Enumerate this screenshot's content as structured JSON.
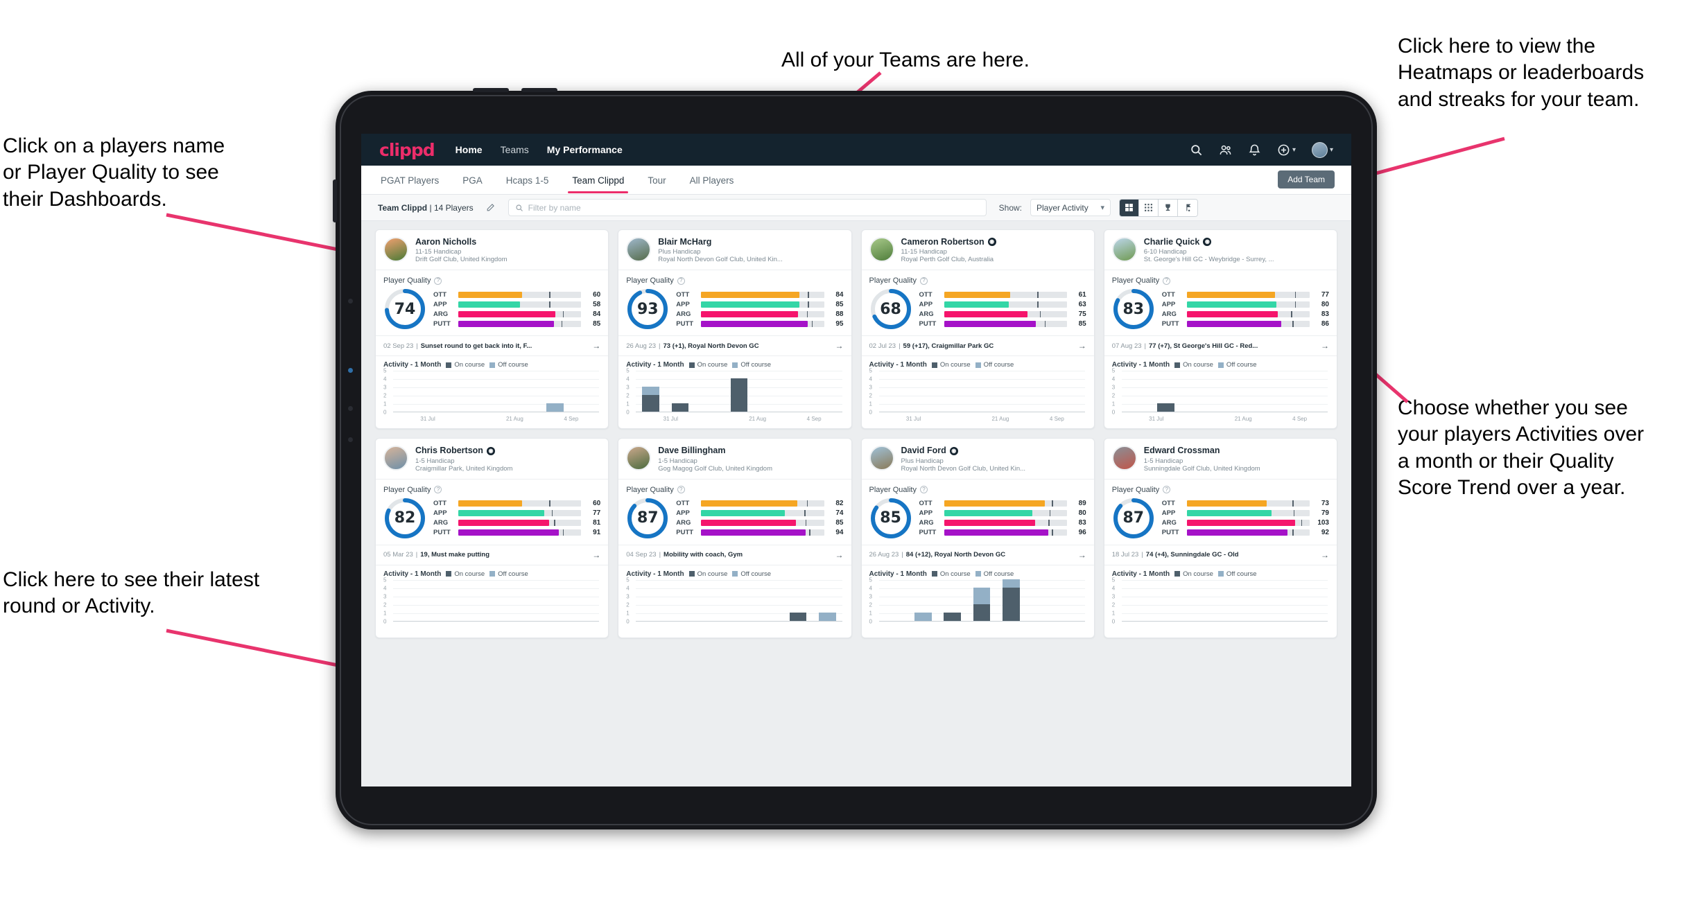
{
  "annotations": [
    {
      "id": "teams",
      "text": "All of your Teams are here."
    },
    {
      "id": "heatmaps",
      "text": "Click here to view the\nHeatmaps or leaderboards\nand streaks for your team."
    },
    {
      "id": "dashboards",
      "text": "Click on a players name\nor Player Quality to see\ntheir Dashboards."
    },
    {
      "id": "choose",
      "text": "Choose whether you see\nyour players Activities over\na month or their Quality\nScore Trend over a year."
    },
    {
      "id": "latest",
      "text": "Click here to see their latest\nround or Activity."
    }
  ],
  "app": {
    "brand": "clippd",
    "nav": [
      {
        "label": "Home",
        "active": true
      },
      {
        "label": "Teams",
        "active": false
      },
      {
        "label": "My Performance",
        "active": true
      }
    ],
    "nav_icons": [
      "search-icon",
      "people-icon",
      "bell-icon",
      "plus-circle-icon",
      "avatar"
    ],
    "tabs": [
      {
        "label": "PGAT Players",
        "active": false
      },
      {
        "label": "PGA",
        "active": false
      },
      {
        "label": "Hcaps 1-5",
        "active": false
      },
      {
        "label": "Team Clippd",
        "active": true
      },
      {
        "label": "Tour",
        "active": false
      },
      {
        "label": "All Players",
        "active": false
      }
    ],
    "add_team_label": "Add Team",
    "filter": {
      "team_name": "Team Clippd",
      "team_sep": "|",
      "player_count": "14 Players",
      "edit_icon": "pencil-icon",
      "search_placeholder": "Filter by name",
      "show_label": "Show:",
      "show_value": "Player Activity",
      "view_buttons": [
        {
          "icon": "grid-large-icon",
          "active": true
        },
        {
          "icon": "grid-small-icon",
          "active": false
        },
        {
          "icon": "trophy-icon",
          "active": false
        },
        {
          "icon": "flag-icon",
          "active": false
        }
      ]
    },
    "card_labels": {
      "player_quality": "Player Quality",
      "activity": "Activity - 1 Month",
      "on_course": "On course",
      "off_course": "Off course",
      "help_icon": "question-icon",
      "arrow_icon": "arrow-right-icon"
    },
    "colors": {
      "brand_pink": "#ec2d6a",
      "navbar": "#14232e",
      "ring": "#1675c4",
      "ott": "#f5a623",
      "app": "#33d6a6",
      "arg": "#f5156c",
      "putt": "#a512c8",
      "on_course": "#4e5f6b",
      "off_course": "#93b0c6"
    },
    "players": [
      {
        "name": "Aaron Nicholls",
        "verified": false,
        "handicap": "11-15 Handicap",
        "club": "Drift Golf Club, United Kingdom",
        "quality": 74,
        "skills": [
          {
            "label": "OTT",
            "value": 60,
            "fill": 52,
            "tick": 74
          },
          {
            "label": "APP",
            "value": 58,
            "fill": 50,
            "tick": 74
          },
          {
            "label": "ARG",
            "value": 84,
            "fill": 79,
            "tick": 85
          },
          {
            "label": "PUTT",
            "value": 85,
            "fill": 78,
            "tick": 84
          }
        ],
        "round": {
          "date": "02 Sep 23",
          "text": "Sunset round to get back into it, F..."
        },
        "chart": {
          "ylabels": [
            5,
            4,
            3,
            2,
            1,
            0
          ],
          "ymax": 5,
          "xlabels": [
            {
              "text": "31 Jul",
              "pos": 16
            },
            {
              "text": "21 Aug",
              "pos": 56
            },
            {
              "text": "4 Sep",
              "pos": 82
            }
          ],
          "bars": [
            {
              "on": 0,
              "off": 0
            },
            {
              "on": 0,
              "off": 0
            },
            {
              "on": 0,
              "off": 0
            },
            {
              "on": 0,
              "off": 0
            },
            {
              "on": 0,
              "off": 0
            },
            {
              "on": 0,
              "off": 1
            },
            {
              "on": 0,
              "off": 0
            }
          ]
        }
      },
      {
        "name": "Blair McHarg",
        "verified": false,
        "handicap": "Plus Handicap",
        "club": "Royal North Devon Golf Club, United Kin...",
        "quality": 93,
        "skills": [
          {
            "label": "OTT",
            "value": 84,
            "fill": 80,
            "tick": 87
          },
          {
            "label": "APP",
            "value": 85,
            "fill": 80,
            "tick": 87
          },
          {
            "label": "ARG",
            "value": 88,
            "fill": 79,
            "tick": 86
          },
          {
            "label": "PUTT",
            "value": 95,
            "fill": 87,
            "tick": 90
          }
        ],
        "round": {
          "date": "26 Aug 23",
          "text": "73 (+1), Royal North Devon GC"
        },
        "chart": {
          "ylabels": [
            5,
            4,
            3,
            2,
            1,
            0
          ],
          "ymax": 5,
          "xlabels": [
            {
              "text": "31 Jul",
              "pos": 16
            },
            {
              "text": "21 Aug",
              "pos": 56
            },
            {
              "text": "4 Sep",
              "pos": 82
            }
          ],
          "bars": [
            {
              "on": 2,
              "off": 1
            },
            {
              "on": 1,
              "off": 0
            },
            {
              "on": 0,
              "off": 0
            },
            {
              "on": 4,
              "off": 0
            },
            {
              "on": 0,
              "off": 0
            },
            {
              "on": 0,
              "off": 0
            },
            {
              "on": 0,
              "off": 0
            }
          ]
        }
      },
      {
        "name": "Cameron Robertson",
        "verified": true,
        "handicap": "11-15 Handicap",
        "club": "Royal Perth Golf Club, Australia",
        "quality": 68,
        "skills": [
          {
            "label": "OTT",
            "value": 61,
            "fill": 54,
            "tick": 76
          },
          {
            "label": "APP",
            "value": 63,
            "fill": 53,
            "tick": 76
          },
          {
            "label": "ARG",
            "value": 75,
            "fill": 68,
            "tick": 78
          },
          {
            "label": "PUTT",
            "value": 85,
            "fill": 75,
            "tick": 82
          }
        ],
        "round": {
          "date": "02 Jul 23",
          "text": "59 (+17), Craigmillar Park GC"
        },
        "chart": {
          "ylabels": [
            5,
            4,
            3,
            2,
            1,
            0
          ],
          "ymax": 5,
          "xlabels": [
            {
              "text": "31 Jul",
              "pos": 16
            },
            {
              "text": "21 Aug",
              "pos": 56
            },
            {
              "text": "4 Sep",
              "pos": 82
            }
          ],
          "bars": [
            {
              "on": 0,
              "off": 0
            },
            {
              "on": 0,
              "off": 0
            },
            {
              "on": 0,
              "off": 0
            },
            {
              "on": 0,
              "off": 0
            },
            {
              "on": 0,
              "off": 0
            },
            {
              "on": 0,
              "off": 0
            },
            {
              "on": 0,
              "off": 0
            }
          ]
        }
      },
      {
        "name": "Charlie Quick",
        "verified": true,
        "handicap": "6-10 Handicap",
        "club": "St. George's Hill GC - Weybridge - Surrey, ...",
        "quality": 83,
        "skills": [
          {
            "label": "OTT",
            "value": 77,
            "fill": 72,
            "tick": 88
          },
          {
            "label": "APP",
            "value": 80,
            "fill": 73,
            "tick": 88
          },
          {
            "label": "ARG",
            "value": 83,
            "fill": 74,
            "tick": 85
          },
          {
            "label": "PUTT",
            "value": 86,
            "fill": 77,
            "tick": 86
          }
        ],
        "round": {
          "date": "07 Aug 23",
          "text": "77 (+7), St George's Hill GC - Red..."
        },
        "chart": {
          "ylabels": [
            5,
            4,
            3,
            2,
            1,
            0
          ],
          "ymax": 5,
          "xlabels": [
            {
              "text": "31 Jul",
              "pos": 16
            },
            {
              "text": "21 Aug",
              "pos": 56
            },
            {
              "text": "4 Sep",
              "pos": 82
            }
          ],
          "bars": [
            {
              "on": 0,
              "off": 0
            },
            {
              "on": 1,
              "off": 0
            },
            {
              "on": 0,
              "off": 0
            },
            {
              "on": 0,
              "off": 0
            },
            {
              "on": 0,
              "off": 0
            },
            {
              "on": 0,
              "off": 0
            },
            {
              "on": 0,
              "off": 0
            }
          ]
        }
      },
      {
        "name": "Chris Robertson",
        "verified": true,
        "handicap": "1-5 Handicap",
        "club": "Craigmillar Park, United Kingdom",
        "quality": 82,
        "skills": [
          {
            "label": "OTT",
            "value": 60,
            "fill": 52,
            "tick": 74
          },
          {
            "label": "APP",
            "value": 77,
            "fill": 70,
            "tick": 76
          },
          {
            "label": "ARG",
            "value": 81,
            "fill": 74,
            "tick": 78
          },
          {
            "label": "PUTT",
            "value": 91,
            "fill": 82,
            "tick": 85
          }
        ],
        "round": {
          "date": "05 Mar 23",
          "text": "19, Must make putting"
        },
        "chart": {
          "ylabels": [
            5,
            4,
            3,
            2,
            1,
            0
          ],
          "ymax": 5,
          "xlabels": [],
          "bars": [
            {
              "on": 0,
              "off": 0
            },
            {
              "on": 0,
              "off": 0
            },
            {
              "on": 0,
              "off": 0
            },
            {
              "on": 0,
              "off": 0
            },
            {
              "on": 0,
              "off": 0
            },
            {
              "on": 0,
              "off": 0
            },
            {
              "on": 0,
              "off": 0
            }
          ]
        }
      },
      {
        "name": "Dave Billingham",
        "verified": false,
        "handicap": "1-5 Handicap",
        "club": "Gog Magog Golf Club, United Kingdom",
        "quality": 87,
        "skills": [
          {
            "label": "OTT",
            "value": 82,
            "fill": 78,
            "tick": 86
          },
          {
            "label": "APP",
            "value": 74,
            "fill": 68,
            "tick": 84
          },
          {
            "label": "ARG",
            "value": 85,
            "fill": 77,
            "tick": 85
          },
          {
            "label": "PUTT",
            "value": 94,
            "fill": 85,
            "tick": 88
          }
        ],
        "round": {
          "date": "04 Sep 23",
          "text": "Mobility with coach, Gym"
        },
        "chart": {
          "ylabels": [
            5,
            4,
            3,
            2,
            1,
            0
          ],
          "ymax": 5,
          "xlabels": [],
          "bars": [
            {
              "on": 0,
              "off": 0
            },
            {
              "on": 0,
              "off": 0
            },
            {
              "on": 0,
              "off": 0
            },
            {
              "on": 0,
              "off": 0
            },
            {
              "on": 0,
              "off": 0
            },
            {
              "on": 1,
              "off": 0
            },
            {
              "on": 0,
              "off": 1
            }
          ]
        }
      },
      {
        "name": "David Ford",
        "verified": true,
        "handicap": "Plus Handicap",
        "club": "Royal North Devon Golf Club, United Kin...",
        "quality": 85,
        "skills": [
          {
            "label": "OTT",
            "value": 89,
            "fill": 82,
            "tick": 88
          },
          {
            "label": "APP",
            "value": 80,
            "fill": 72,
            "tick": 86
          },
          {
            "label": "ARG",
            "value": 83,
            "fill": 74,
            "tick": 85
          },
          {
            "label": "PUTT",
            "value": 96,
            "fill": 85,
            "tick": 88
          }
        ],
        "round": {
          "date": "26 Aug 23",
          "text": "84 (+12), Royal North Devon GC"
        },
        "chart": {
          "ylabels": [
            5,
            4,
            3,
            2,
            1,
            0
          ],
          "ymax": 5,
          "xlabels": [],
          "bars": [
            {
              "on": 0,
              "off": 0
            },
            {
              "on": 0,
              "off": 1
            },
            {
              "on": 1,
              "off": 0
            },
            {
              "on": 2,
              "off": 2
            },
            {
              "on": 4,
              "off": 1
            },
            {
              "on": 0,
              "off": 0
            },
            {
              "on": 0,
              "off": 0
            }
          ]
        }
      },
      {
        "name": "Edward Crossman",
        "verified": false,
        "handicap": "1-5 Handicap",
        "club": "Sunningdale Golf Club, United Kingdom",
        "quality": 87,
        "skills": [
          {
            "label": "OTT",
            "value": 73,
            "fill": 65,
            "tick": 86
          },
          {
            "label": "APP",
            "value": 79,
            "fill": 69,
            "tick": 87
          },
          {
            "label": "ARG",
            "value": 103,
            "fill": 88,
            "tick": 93
          },
          {
            "label": "PUTT",
            "value": 92,
            "fill": 82,
            "tick": 86
          }
        ],
        "round": {
          "date": "18 Jul 23",
          "text": "74 (+4), Sunningdale GC - Old"
        },
        "chart": {
          "ylabels": [
            5,
            4,
            3,
            2,
            1,
            0
          ],
          "ymax": 5,
          "xlabels": [],
          "bars": [
            {
              "on": 0,
              "off": 0
            },
            {
              "on": 0,
              "off": 0
            },
            {
              "on": 0,
              "off": 0
            },
            {
              "on": 0,
              "off": 0
            },
            {
              "on": 0,
              "off": 0
            },
            {
              "on": 0,
              "off": 0
            },
            {
              "on": 0,
              "off": 0
            }
          ]
        }
      }
    ]
  }
}
